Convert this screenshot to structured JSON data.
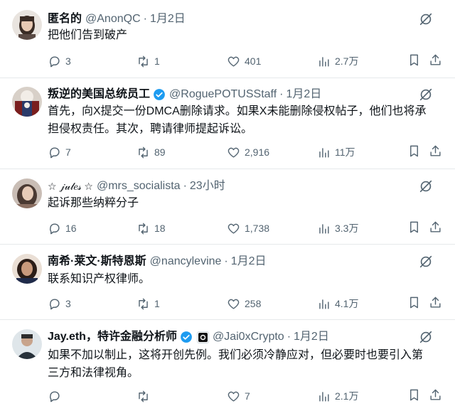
{
  "tweets": [
    {
      "name": "匿名的",
      "handle": "@AnonQC",
      "time": "1月2日",
      "text": "把他们告到破产",
      "replies": "3",
      "reposts": "1",
      "likes": "401",
      "views": "2.7万",
      "verified": false
    },
    {
      "name": "叛逆的美国总统员工",
      "handle": "@RoguePOTUSStaff",
      "time": "1月2日",
      "text": "首先，向X提交一份DMCA删除请求。如果X未能删除侵权帖子，他们也将承担侵权责任。其次，聘请律师提起诉讼。",
      "replies": "7",
      "reposts": "89",
      "likes": "2,916",
      "views": "11万",
      "verified": true
    },
    {
      "name": "☆ 𝒿𝓊𝓁𝑒𝓈 ☆",
      "handle": "@mrs_socialista",
      "time": "23小时",
      "text": "起诉那些纳粹分子",
      "replies": "16",
      "reposts": "18",
      "likes": "1,738",
      "views": "3.3万",
      "verified": false
    },
    {
      "name": "南希·莱文·斯特恩斯",
      "handle": "@nancylevine",
      "time": "1月2日",
      "text": "联系知识产权律师。",
      "replies": "3",
      "reposts": "1",
      "likes": "258",
      "views": "4.1万",
      "verified": false
    },
    {
      "name": "Jay.eth，特许金融分析师",
      "handle": "@Jai0xCrypto",
      "time": "1月2日",
      "text": "如果不加以制止，这将开创先例。我们必须冷静应对，但必要时也要引入第三方和法律视角。",
      "replies": "",
      "reposts": "",
      "likes": "7",
      "views": "2.1万",
      "verified": true
    }
  ],
  "icons": {
    "reply": "reply-icon",
    "repost": "repost-icon",
    "like": "like-icon",
    "views": "views-icon",
    "bookmark": "bookmark-icon",
    "share": "share-icon",
    "grok": "grok-icon",
    "verified": "verified-badge-icon"
  },
  "colors": {
    "text": "#0f1419",
    "secondary": "#536471",
    "verified": "#1d9bf0",
    "divider": "#e6e9eb"
  }
}
